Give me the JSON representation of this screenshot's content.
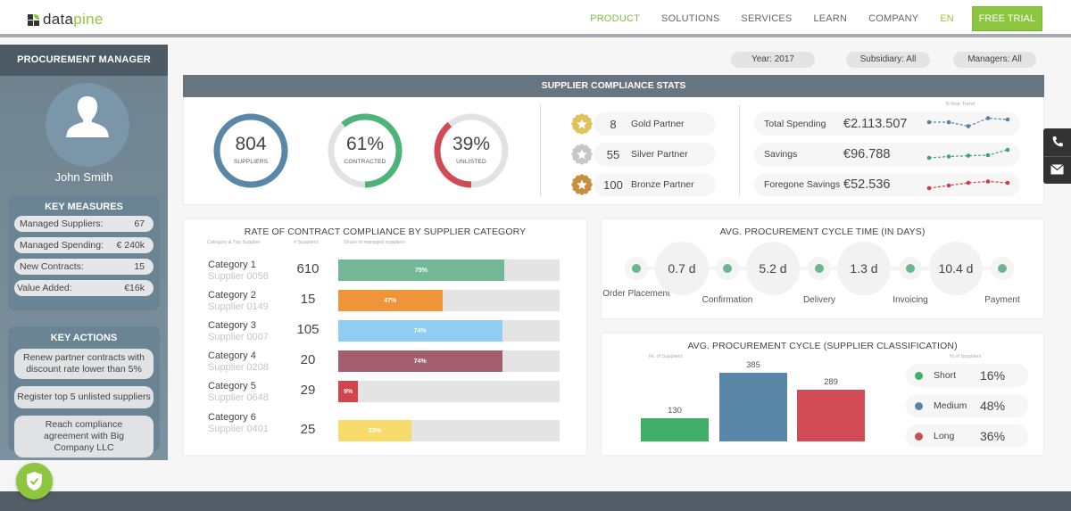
{
  "brand": {
    "name_a": "data",
    "name_b": "pine"
  },
  "nav": {
    "items": [
      "PRODUCT",
      "SOLUTIONS",
      "SERVICES",
      "LEARN",
      "COMPANY"
    ],
    "lang": "EN",
    "cta": "FREE TRIAL"
  },
  "sidebar": {
    "title": "PROCUREMENT MANAGER",
    "user_name": "John Smith",
    "key_measures_title": "KEY MEASURES",
    "key_measures": [
      {
        "label": "Managed Suppliers:",
        "value": "67"
      },
      {
        "label": "Managed Spending:",
        "value": "€ 240k"
      },
      {
        "label": "New Contracts:",
        "value": "15"
      },
      {
        "label": "Value Added:",
        "value": "€16k"
      }
    ],
    "key_actions_title": "KEY ACTIONS",
    "key_actions": [
      "Renew partner contracts with discount rate lower than 5%",
      "Register top 5 unlisted suppliers",
      "Reach compliance agreement with Big Company LLC"
    ]
  },
  "filters": [
    "Year: 2017",
    "Subsidiary: All",
    "Managers: All"
  ],
  "compliance_stats": {
    "title": "SUPPLIER COMPLIANCE STATS",
    "rings": [
      {
        "value": "804",
        "label": "SUPPLIERS",
        "fraction": 1.0,
        "color": "#5a86a8"
      },
      {
        "value": "61%",
        "label": "CONTRACTED",
        "fraction": 0.61,
        "color": "#4db378"
      },
      {
        "value": "39%",
        "label": "UNLISTED",
        "fraction": 0.39,
        "color": "#d14b55"
      }
    ],
    "partners": [
      {
        "count": "8",
        "name": "Gold Partner",
        "color": "#e2c25a"
      },
      {
        "count": "55",
        "name": "Silver Partner",
        "color": "#c8c8c8"
      },
      {
        "count": "100",
        "name": "Bronze Partner",
        "color": "#c98d3e"
      }
    ],
    "trend_label": "5-Year-Trend",
    "spending": [
      {
        "label": "Total Spending",
        "value": "€2.113.507",
        "color": "#5a7fa3",
        "trend": [
          3,
          3,
          1.5,
          4.5,
          4
        ]
      },
      {
        "label": "Savings",
        "value": "€96.788",
        "color": "#3ea56a",
        "trend": [
          1,
          1.5,
          1.8,
          2,
          4
        ]
      },
      {
        "label": "Foregone Savings",
        "value": "€52.536",
        "color": "#cc3e44",
        "trend": [
          1,
          2,
          3,
          3.5,
          3
        ]
      }
    ]
  },
  "contract_compliance": {
    "title": "RATE OF CONTRACT COMPLIANCE BY SUPPLIER CATEGORY",
    "col_headers": [
      "Category & Top Supplier",
      "# Suppliers",
      "Share of managed suppliers"
    ],
    "rows": [
      {
        "category": "Category 1",
        "supplier": "Supplier 0056",
        "count": "610",
        "share": 75,
        "share_label": "75%",
        "color": "#72b897"
      },
      {
        "category": "Category 2",
        "supplier": "Supplier 0149",
        "count": "15",
        "share": 47,
        "share_label": "47%",
        "color": "#f0943a"
      },
      {
        "category": "Category 3",
        "supplier": "Supplier 0007",
        "count": "105",
        "share": 74,
        "share_label": "74%",
        "color": "#8fcdf2"
      },
      {
        "category": "Category 4",
        "supplier": "Supplier 0208",
        "count": "20",
        "share": 74,
        "share_label": "74%",
        "color": "#a25e6c"
      },
      {
        "category": "Category 5",
        "supplier": "Supplier 0648",
        "count": "29",
        "share": 9,
        "share_label": "9%",
        "color": "#d2434b"
      },
      {
        "category": "Category 6",
        "supplier": "Supplier 0401",
        "count": "25",
        "share": 33,
        "share_label": "33%",
        "color": "#f7dc6b"
      }
    ]
  },
  "cycle_time": {
    "title": "AVG. PROCUREMENT CYCLE TIME (IN DAYS)",
    "stages": [
      "Order Placement",
      "Confirmation",
      "Delivery",
      "Invoicing",
      "Payment"
    ],
    "durations": [
      "0.7 d",
      "5.2 d",
      "1.3 d",
      "10.4 d"
    ]
  },
  "chart_data": {
    "type": "bar",
    "title": "AVG. PROCUREMENT CYCLE (SUPPLIER CLASSIFICATION)",
    "ylabel": "Nr. of Suppliers",
    "categories": [
      "Short",
      "Medium",
      "Long"
    ],
    "values": [
      130,
      385,
      289
    ],
    "colors": [
      "#3fae66",
      "#5a86a8",
      "#d14b55"
    ],
    "ylim": [
      0,
      420
    ],
    "grid": false,
    "legend_title": "% of Suppliers",
    "legend_position": "right",
    "shares": [
      "16%",
      "48%",
      "36%"
    ]
  }
}
